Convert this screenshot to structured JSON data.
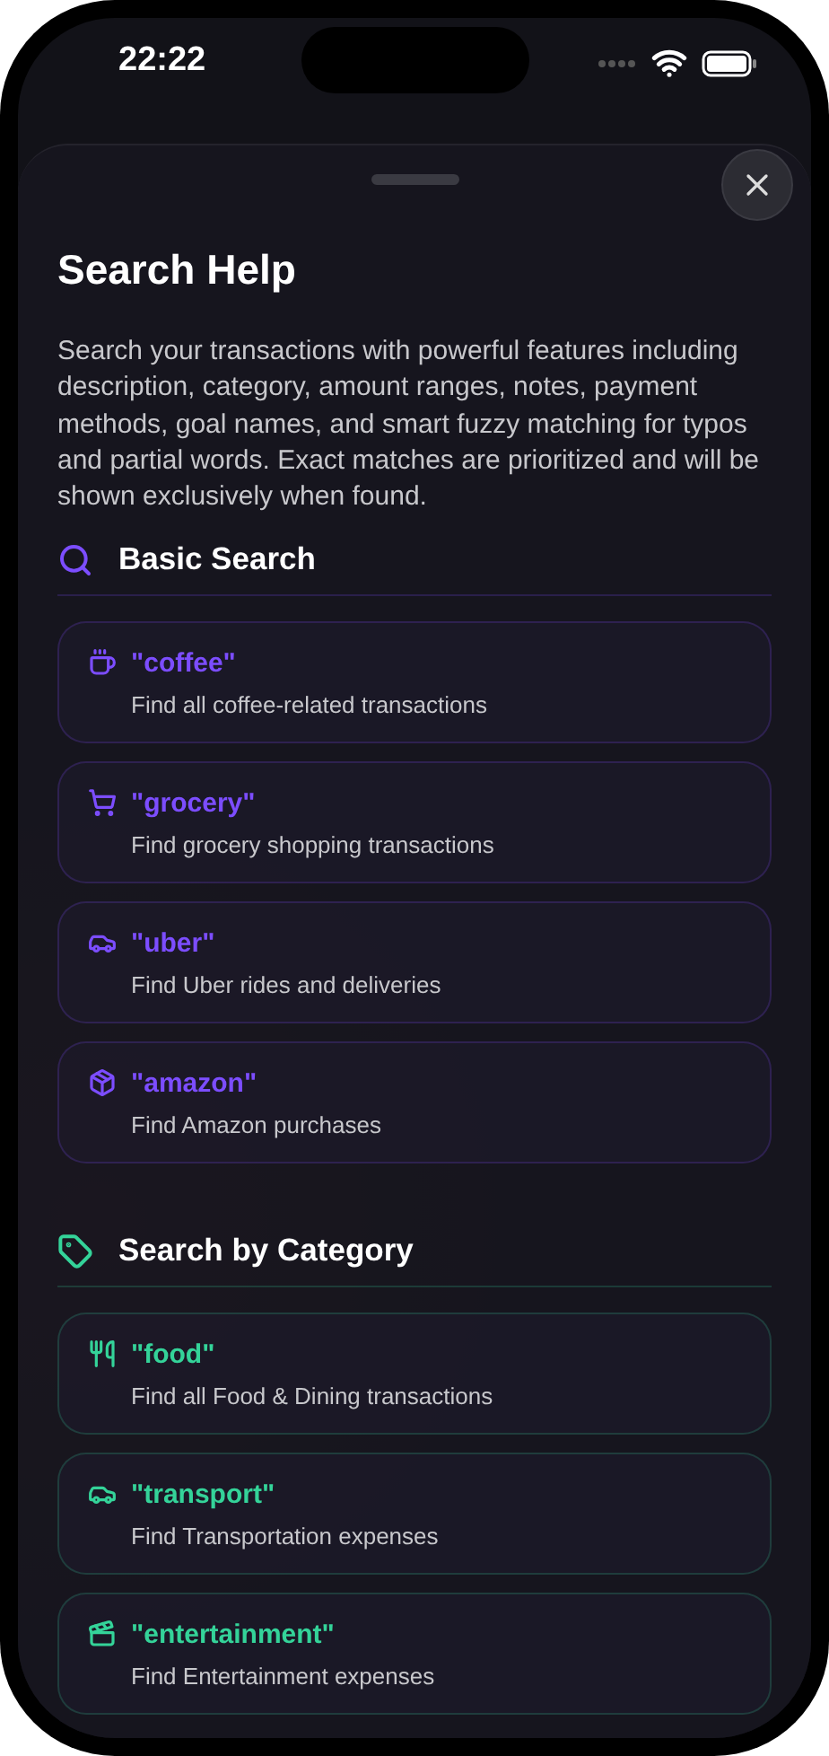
{
  "status_bar": {
    "time": "22:22"
  },
  "sheet": {
    "title": "Search Help",
    "description": "Search your transactions with powerful features including description, category, amount ranges, notes, payment methods, goal names, and smart fuzzy matching for typos and partial words. Exact matches are prioritized and will be shown exclusively when found."
  },
  "sections": [
    {
      "title": "Basic Search",
      "kind": "search",
      "color": "#7c4dff",
      "items": [
        {
          "kind": "coffee",
          "query": "\"coffee\"",
          "description": "Find all coffee-related transactions"
        },
        {
          "kind": "cart",
          "query": "\"grocery\"",
          "description": "Find grocery shopping transactions"
        },
        {
          "kind": "car",
          "query": "\"uber\"",
          "description": "Find Uber rides and deliveries"
        },
        {
          "kind": "package",
          "query": "\"amazon\"",
          "description": "Find Amazon purchases"
        }
      ]
    },
    {
      "title": "Search by Category",
      "kind": "tag",
      "color": "#34d399",
      "items": [
        {
          "kind": "food",
          "query": "\"food\"",
          "description": "Find all Food & Dining transactions"
        },
        {
          "kind": "car",
          "query": "\"transport\"",
          "description": "Find Transportation expenses"
        },
        {
          "kind": "clapper",
          "query": "\"entertainment\"",
          "description": "Find Entertainment expenses"
        }
      ]
    }
  ]
}
